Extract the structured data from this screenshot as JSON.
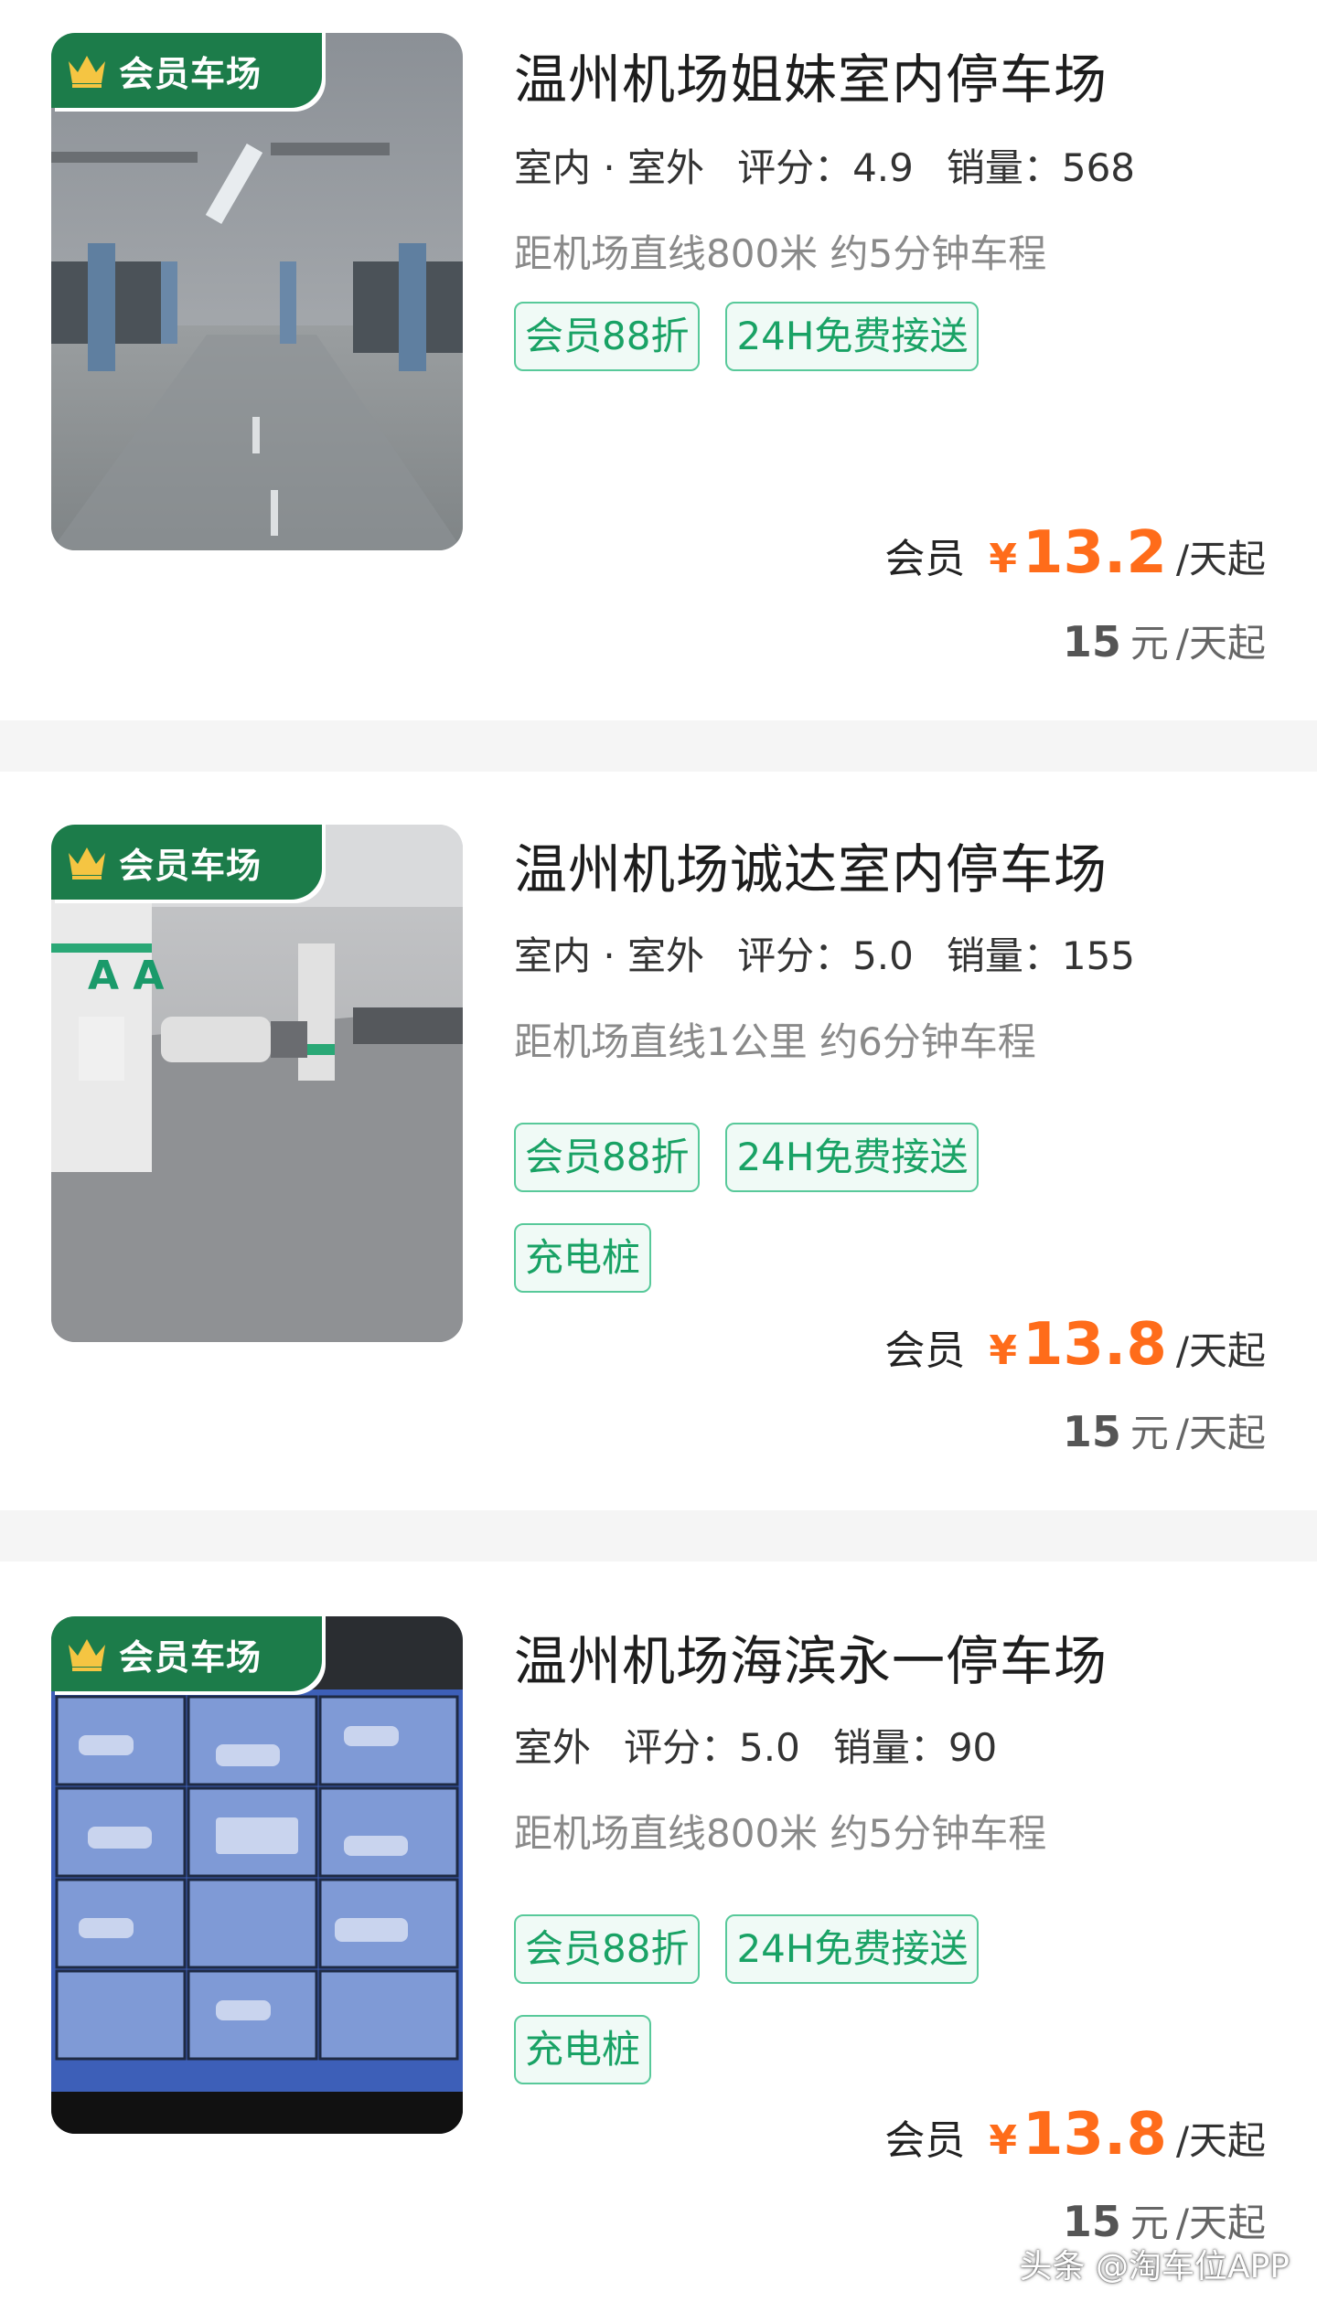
{
  "colors": {
    "accent": "#19a265",
    "price": "#ff6c1a",
    "badge_bg": "#1c7c4a",
    "separator": "#f5f5f5"
  },
  "listings": [
    {
      "badge": "会员车场",
      "title": "温州机场姐妹室内停车场",
      "type": "室内 · 室外",
      "rating": "评分：4.9",
      "sales": "销量：568",
      "distance": "距机场直线800米 约5分钟车程",
      "tags": [
        "会员88折",
        "24H免费接送"
      ],
      "vip_label": "会员",
      "currency": "¥",
      "vip_price": "13.2",
      "unit": "/天起",
      "std_price": "15",
      "std_currency": "元",
      "image_icon": "indoor-parking-photo"
    },
    {
      "badge": "会员车场",
      "title": "温州机场诚达室内停车场",
      "type": "室内 · 室外",
      "rating": "评分：5.0",
      "sales": "销量：155",
      "distance": "距机场直线1公里 约6分钟车程",
      "tags": [
        "会员88折",
        "24H免费接送",
        "充电桩"
      ],
      "vip_label": "会员",
      "currency": "¥",
      "vip_price": "13.8",
      "unit": "/天起",
      "std_price": "15",
      "std_currency": "元",
      "image_icon": "indoor-parking-photo"
    },
    {
      "badge": "会员车场",
      "title": "温州机场海滨永一停车场",
      "type": "室外",
      "rating": "评分：5.0",
      "sales": "销量：90",
      "distance": "距机场直线800米 约5分钟车程",
      "tags": [
        "会员88折",
        "24H免费接送",
        "充电桩"
      ],
      "vip_label": "会员",
      "currency": "¥",
      "vip_price": "13.8",
      "unit": "/天起",
      "std_price": "15",
      "std_currency": "元",
      "image_icon": "cctv-monitor-photo"
    }
  ],
  "watermark": "头条 @淘车位APP"
}
